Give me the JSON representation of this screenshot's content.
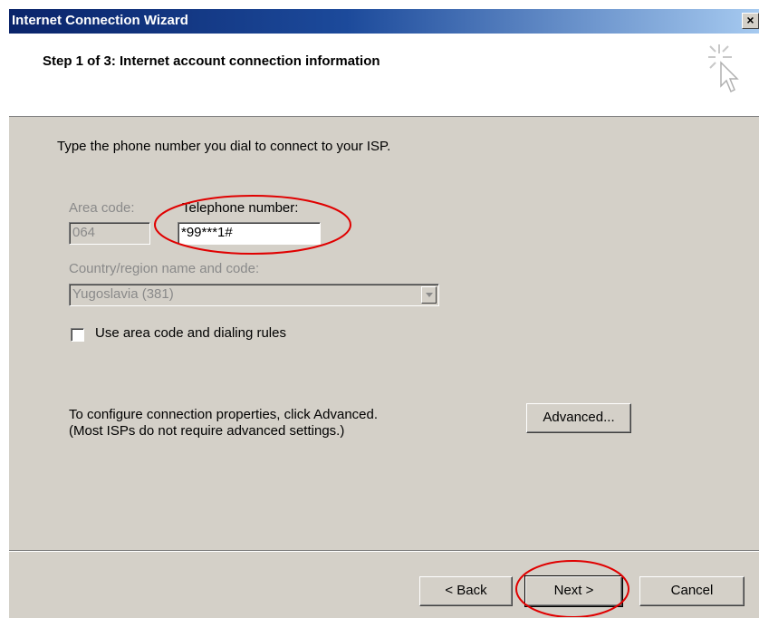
{
  "window": {
    "title": "Internet Connection Wizard",
    "close_glyph": "×"
  },
  "header": {
    "step_title": "Step 1 of 3: Internet account connection information",
    "icon": "wizard-cursor-icon"
  },
  "content": {
    "instruction": "Type the phone number you dial to connect to your ISP.",
    "area_code_label": "Area code:",
    "area_code_value": "064",
    "telephone_label": "Telephone number:",
    "telephone_value": "*99***1#",
    "country_label": "Country/region name and code:",
    "country_value": "Yugoslavia (381)",
    "use_area_code_label": "Use area code and dialing rules",
    "use_area_code_checked": false,
    "advanced_note_line1": "To configure connection properties, click Advanced.",
    "advanced_note_line2": "(Most ISPs do not require advanced settings.)",
    "advanced_button": "Advanced..."
  },
  "footer": {
    "back_button": "< Back",
    "next_button": "Next >",
    "cancel_button": "Cancel"
  },
  "colors": {
    "titlebar_start": "#0a246a",
    "titlebar_end": "#a6caf0",
    "dialog_face": "#d4d0c8",
    "annotation": "#e00000"
  }
}
